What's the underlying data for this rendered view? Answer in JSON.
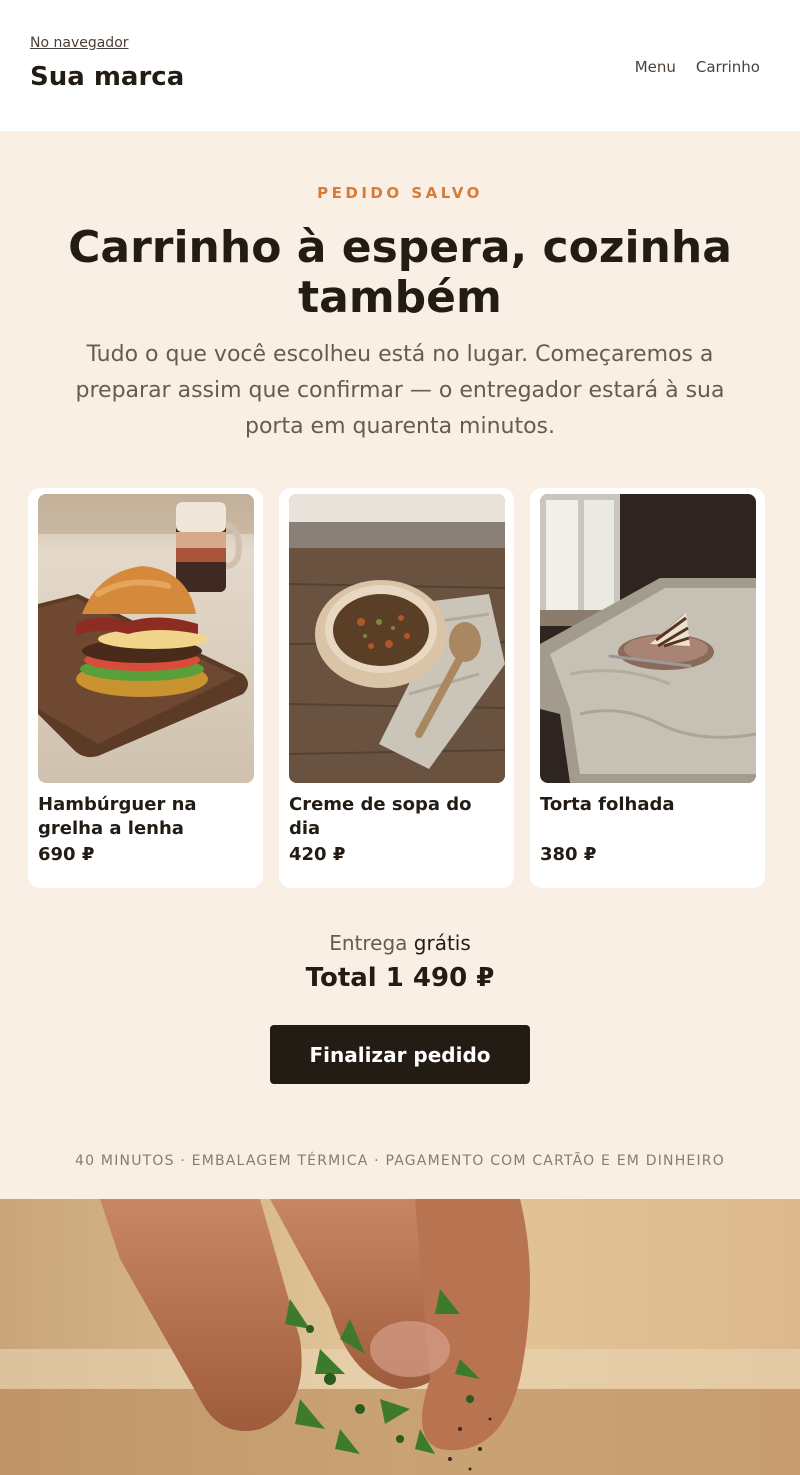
{
  "header": {
    "browser_link": "No navegador",
    "brand": "Sua marca",
    "nav": [
      "Menu",
      "Carrinho"
    ]
  },
  "hero": {
    "eyebrow": "PEDIDO SALVO",
    "title": "Carrinho à espera, cozinha também",
    "lede": "Tudo o que você escolheu está no lugar. Começaremos a preparar assim que confirmar — o entregador estará à sua porta em quarenta minutos."
  },
  "items": [
    {
      "name": "Hambúrguer na grelha a lenha",
      "price": "690 ₽",
      "image": "burger-photo"
    },
    {
      "name": "Creme de sopa do dia",
      "price": "420 ₽",
      "image": "soup-photo"
    },
    {
      "name": "Torta folhada",
      "price": "380 ₽",
      "image": "cake-photo"
    }
  ],
  "summary": {
    "delivery_label": "Entrega",
    "delivery_value": "grátis",
    "total": "Total 1 490 ₽",
    "cta": "Finalizar pedido"
  },
  "footnote": "40 MINUTOS · EMBALAGEM TÉRMICA · PAGAMENTO COM CARTÃO E EM DINHEIRO",
  "colors": {
    "accent": "#d77b36",
    "cream": "#f9efe4",
    "dark": "#231c15",
    "muted": "#6a5b4f"
  }
}
